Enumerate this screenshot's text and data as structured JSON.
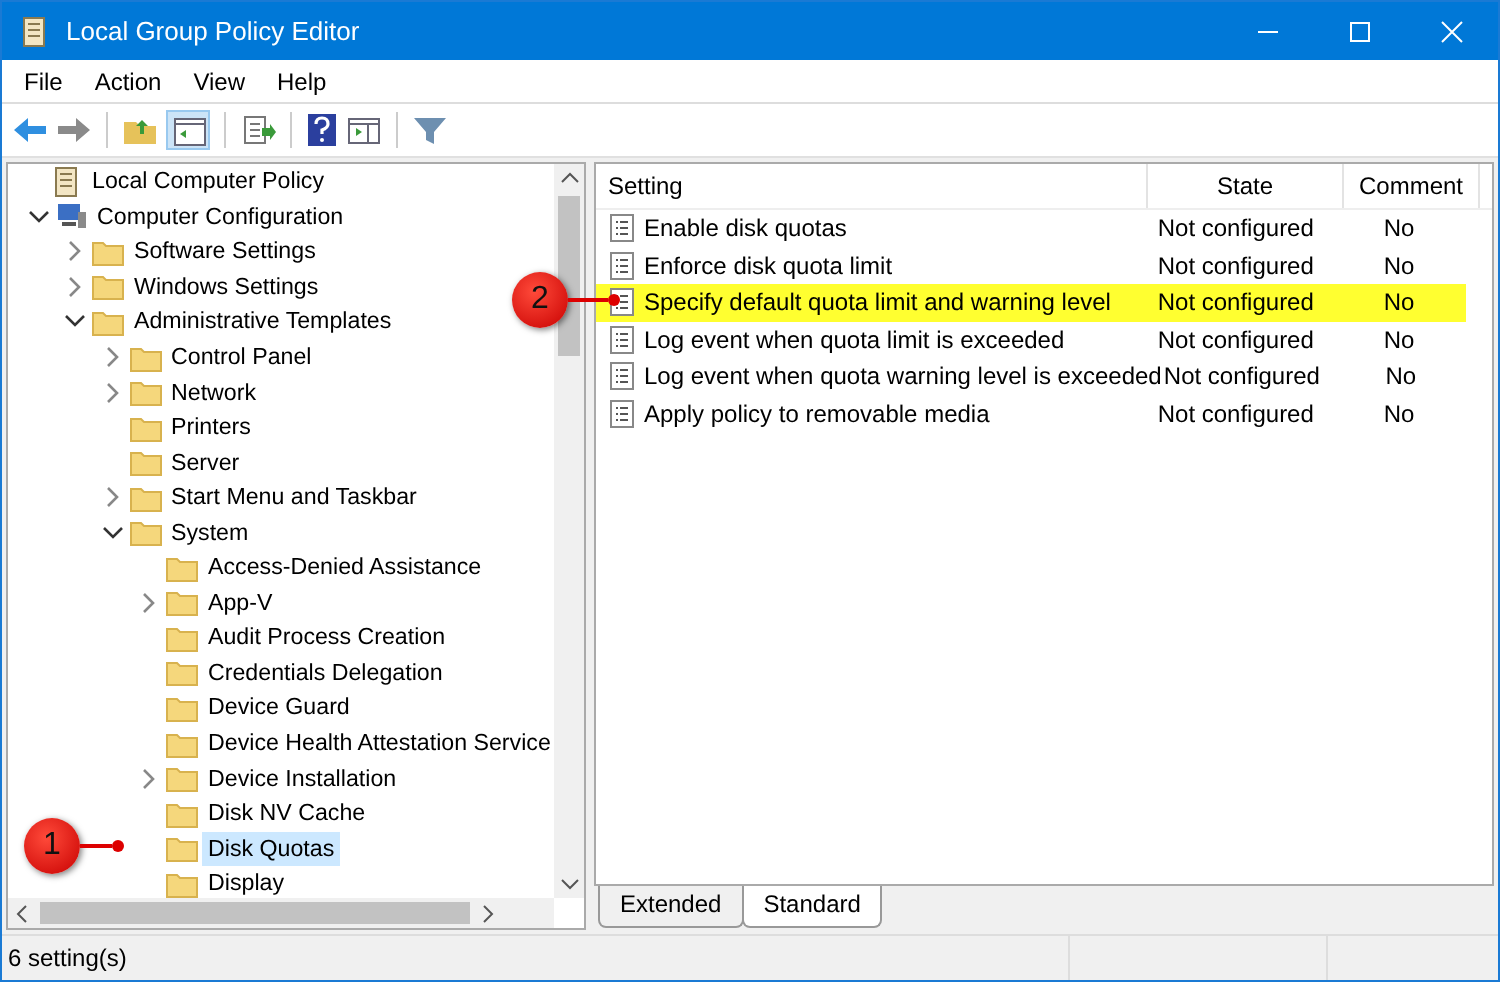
{
  "window": {
    "title": "Local Group Policy Editor"
  },
  "menu": [
    "File",
    "Action",
    "View",
    "Help"
  ],
  "tree": [
    {
      "label": "Local Computer Policy",
      "kind": "policy",
      "selected": false,
      "children": [
        {
          "label": "Computer Configuration",
          "kind": "computer",
          "expanded": true,
          "selected": false,
          "children": [
            {
              "label": "Software Settings",
              "kind": "folder",
              "expanded": false,
              "selected": false
            },
            {
              "label": "Windows Settings",
              "kind": "folder",
              "expanded": false,
              "selected": false
            },
            {
              "label": "Administrative Templates",
              "kind": "folder",
              "expanded": true,
              "selected": false,
              "children": [
                {
                  "label": "Control Panel",
                  "kind": "folder",
                  "expanded": false,
                  "selected": false
                },
                {
                  "label": "Network",
                  "kind": "folder",
                  "expanded": false,
                  "selected": false
                },
                {
                  "label": "Printers",
                  "kind": "folder",
                  "selected": false
                },
                {
                  "label": "Server",
                  "kind": "folder",
                  "selected": false
                },
                {
                  "label": "Start Menu and Taskbar",
                  "kind": "folder",
                  "expanded": false,
                  "selected": false
                },
                {
                  "label": "System",
                  "kind": "folder",
                  "expanded": true,
                  "selected": false,
                  "children": [
                    {
                      "label": "Access-Denied Assistance",
                      "kind": "folder",
                      "selected": false
                    },
                    {
                      "label": "App-V",
                      "kind": "folder",
                      "expanded": false,
                      "selected": false
                    },
                    {
                      "label": "Audit Process Creation",
                      "kind": "folder",
                      "selected": false
                    },
                    {
                      "label": "Credentials Delegation",
                      "kind": "folder",
                      "selected": false
                    },
                    {
                      "label": "Device Guard",
                      "kind": "folder",
                      "selected": false
                    },
                    {
                      "label": "Device Health Attestation Service",
                      "kind": "folder",
                      "selected": false
                    },
                    {
                      "label": "Device Installation",
                      "kind": "folder",
                      "expanded": false,
                      "selected": false
                    },
                    {
                      "label": "Disk NV Cache",
                      "kind": "folder",
                      "selected": false
                    },
                    {
                      "label": "Disk Quotas",
                      "kind": "folder",
                      "selected": true
                    },
                    {
                      "label": "Display",
                      "kind": "folder",
                      "selected": false
                    }
                  ]
                }
              ]
            }
          ]
        }
      ]
    }
  ],
  "table": {
    "columns": [
      "Setting",
      "State",
      "Comment"
    ],
    "rows": [
      {
        "setting": "Enable disk quotas",
        "state": "Not configured",
        "comment": "No",
        "highlighted": false
      },
      {
        "setting": "Enforce disk quota limit",
        "state": "Not configured",
        "comment": "No",
        "highlighted": false
      },
      {
        "setting": "Specify default quota limit and warning level",
        "state": "Not configured",
        "comment": "No",
        "highlighted": true
      },
      {
        "setting": "Log event when quota limit is exceeded",
        "state": "Not configured",
        "comment": "No",
        "highlighted": false
      },
      {
        "setting": "Log event when quota warning level is exceeded",
        "state": "Not configured",
        "comment": "No",
        "highlighted": false
      },
      {
        "setting": "Apply policy to removable media",
        "state": "Not configured",
        "comment": "No",
        "highlighted": false
      }
    ]
  },
  "view_tabs": [
    {
      "label": "Extended",
      "selected": false
    },
    {
      "label": "Standard",
      "selected": true
    }
  ],
  "callouts": [
    "1",
    "2"
  ],
  "status_bar": "6 setting(s)"
}
